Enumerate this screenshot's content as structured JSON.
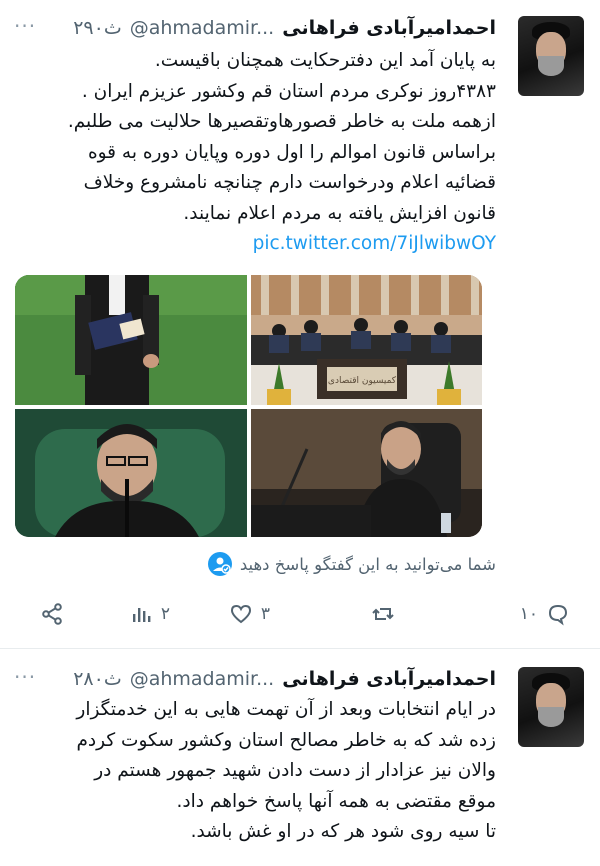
{
  "tweets": [
    {
      "author_name": "احمدامیرآبادی فراهانی",
      "handle": "@ahmadamir...",
      "time": "۲۹۰ث",
      "more": "···",
      "avatar_signature": "امضا",
      "lines": [
        "به پایان آمد این دفترحکایت همچنان باقیست.",
        "۴۳۸۳روز نوکری مردم استان قم وکشور عزیزم ایران .",
        "ازهمه ملت به خاطر قصورهاوتقصیرها حلالیت می طلبم.",
        "براساس قانون اموالم را اول دوره وپایان دوره به قوه",
        "قضائیه اعلام ودرخواست دارم چنانچه نامشروع وخلاف",
        "قانون افزایش یافته به مردم اعلام نمایند."
      ],
      "link": "pic.twitter.com/7iJlwibwOY",
      "photos": [
        {
          "alt": "مرد با کت و شلوار و پوشه در دست"
        },
        {
          "alt": "جلسه کمیسیون"
        },
        {
          "alt": "سخنرانی پشت میکروفون"
        },
        {
          "alt": "مرد در صندلی جلسه"
        }
      ],
      "sign_text": "کمیسیون اقتصادی",
      "reply_note": "شما می‌توانید به این گفتگو پاسخ دهید",
      "actions": {
        "reply_count": "۱۰",
        "retweet_count": "",
        "like_count": "۳",
        "views_count": "۲"
      }
    },
    {
      "author_name": "احمدامیرآبادی فراهانی",
      "handle": "@ahmadamir...",
      "time": "۲۸۰ث",
      "more": "···",
      "avatar_signature": "امضا",
      "lines": [
        "در ایام انتخابات وبعد از آن تهمت هایی به این خدمتگزار",
        "زده شد که به خاطر مصالح استان وکشور سکوت کردم",
        "والان نیز عزادار از دست دادن شهید جمهور هستم در",
        "موقع مقتضی به همه آنها پاسخ خواهم داد.",
        "تا سیه روی شود هر که در او غش باشد."
      ]
    }
  ],
  "colors": {
    "link": "#1d9bf0",
    "muted": "#536471",
    "text": "#0f1419"
  }
}
